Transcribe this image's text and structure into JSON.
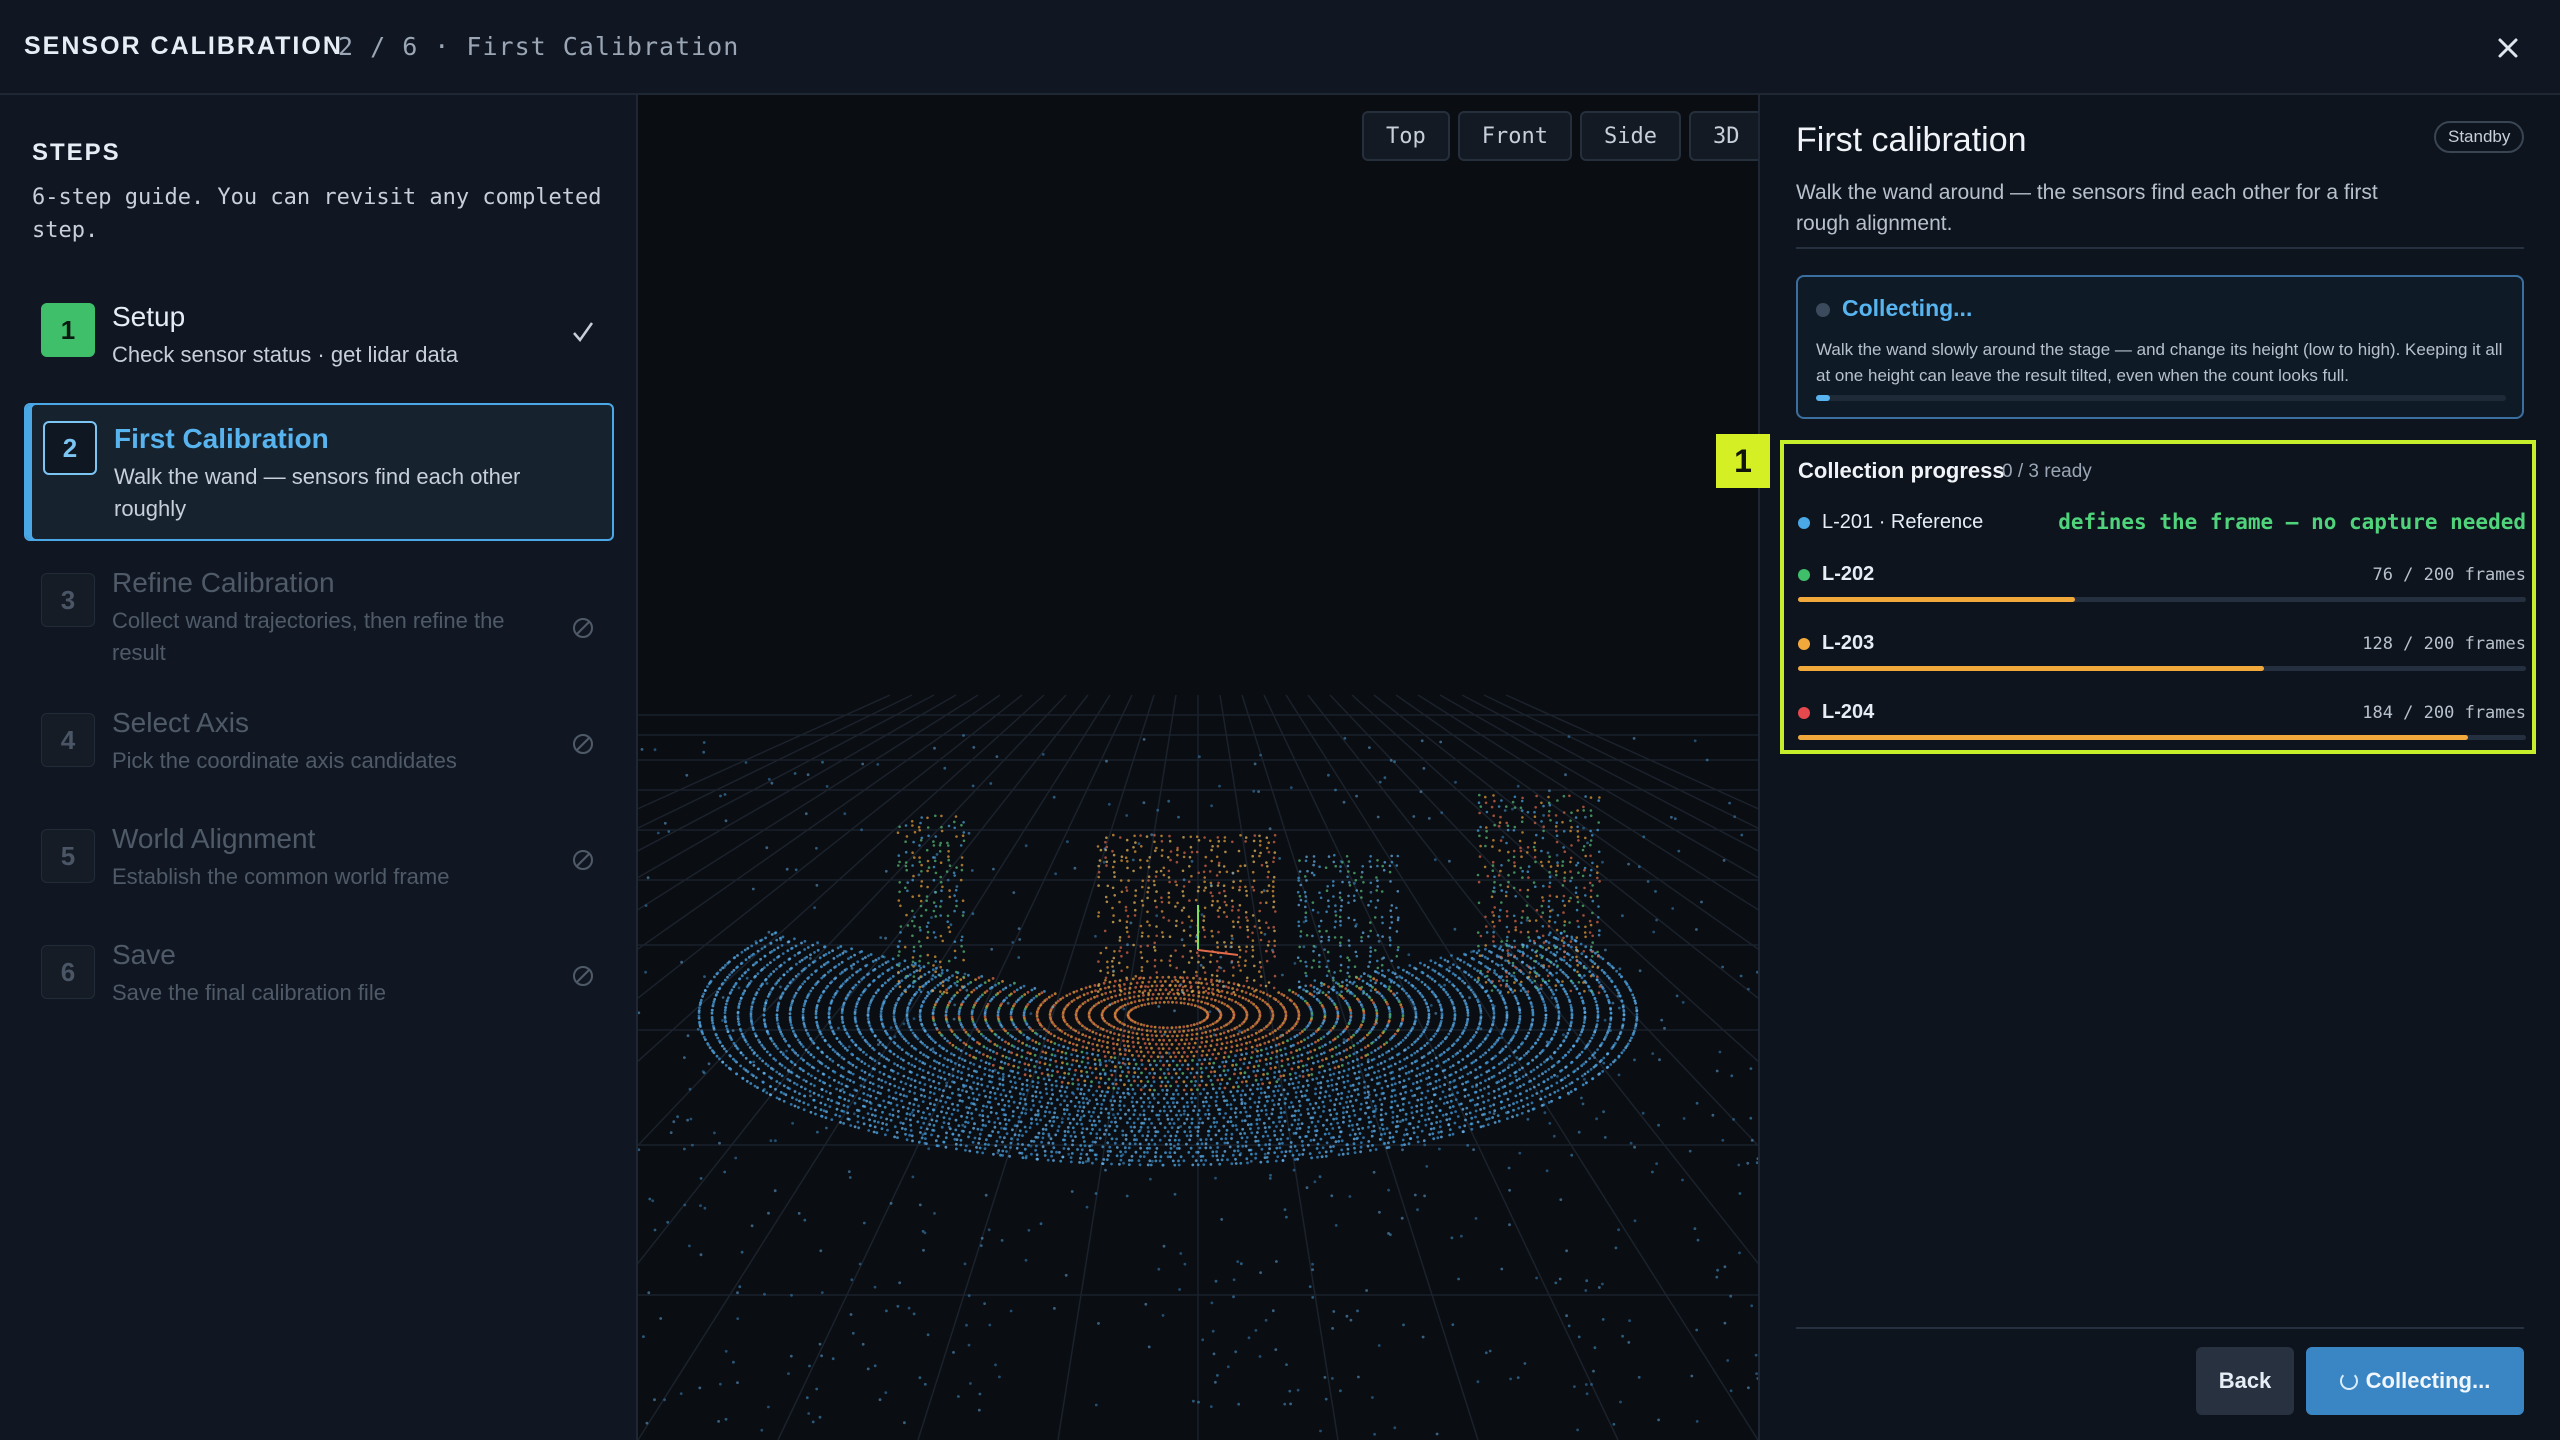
{
  "header": {
    "title": "SENSOR CALIBRATION",
    "breadcrumb": "2 / 6 · First Calibration"
  },
  "sidebar": {
    "heading": "STEPS",
    "subtitle": "6-step guide. You can revisit any completed step.",
    "steps": [
      {
        "number": "1",
        "title": "Setup",
        "desc": "Check sensor status · get lidar data",
        "state": "done"
      },
      {
        "number": "2",
        "title": "First Calibration",
        "desc": "Walk the wand — sensors find each other roughly",
        "state": "active"
      },
      {
        "number": "3",
        "title": "Refine Calibration",
        "desc": "Collect wand trajectories, then refine the result",
        "state": "locked"
      },
      {
        "number": "4",
        "title": "Select Axis",
        "desc": "Pick the coordinate axis candidates",
        "state": "locked"
      },
      {
        "number": "5",
        "title": "World Alignment",
        "desc": "Establish the common world frame",
        "state": "locked"
      },
      {
        "number": "6",
        "title": "Save",
        "desc": "Save the final calibration file",
        "state": "locked"
      }
    ]
  },
  "viewport": {
    "views": [
      "Top",
      "Front",
      "Side",
      "3D"
    ]
  },
  "panel": {
    "title": "First calibration",
    "badge": "Standby",
    "description": "Walk the wand around — the sensors find each other for a first rough alignment.",
    "status": {
      "label": "Collecting...",
      "text": "Walk the wand slowly around the stage — and change its height (low to high). Keeping it all at one height can leave the result tilted, even when the count looks full.",
      "progress": 0.02,
      "color": "#58b4ef"
    },
    "callout": "1",
    "progress": {
      "title": "Collection progress",
      "ready": "0 / 3 ready",
      "reference": {
        "name": "L-201 · Reference",
        "note": "defines the frame — no capture needed",
        "color": "#4aa8e6"
      },
      "sensors": [
        {
          "name": "L-202",
          "frames": "76 / 200 frames",
          "fraction": 0.38,
          "color": "#3fbf6a"
        },
        {
          "name": "L-203",
          "frames": "128 / 200 frames",
          "fraction": 0.64,
          "color": "#f2a93b"
        },
        {
          "name": "L-204",
          "frames": "184 / 200 frames",
          "fraction": 0.92,
          "color": "#e5484d"
        }
      ]
    },
    "back_label": "Back",
    "collect_label": "Collecting..."
  }
}
